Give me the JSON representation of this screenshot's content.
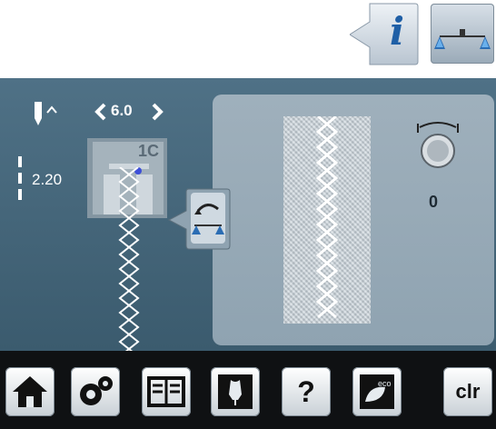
{
  "top_buttons": {
    "info_label": "i",
    "balance_icon": "balance-icon"
  },
  "screen": {
    "presser_foot_icon": "needle-up-icon",
    "stitch_width": "6.0",
    "needle_position": "2.20",
    "presser_foot_number": "1C",
    "counter_value": "0",
    "colors": {
      "screen_bg": "#3b5b6e",
      "panel_bg": "#9fb0bc",
      "stitch_color": "#ffffff",
      "accent": "#2a6fb5"
    }
  },
  "bottom_bar": {
    "home": "home-icon",
    "settings": "settings-icon",
    "program": "program-icon",
    "personal_program": "dress-form-icon",
    "help_label": "?",
    "eco_label": "eco",
    "clear_label": "clr"
  }
}
